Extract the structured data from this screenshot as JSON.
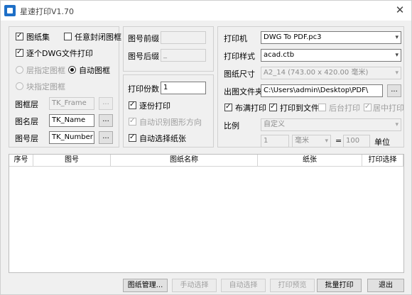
{
  "window": {
    "title": "星速打印V1.70",
    "close_glyph": "✕"
  },
  "left": {
    "frame_checkbox_label": "图纸集",
    "any_closed_label": "任意封闭图框",
    "per_dwg_label": "逐个DWG文件打印",
    "layer_frame_label": "层指定图框",
    "auto_frame_label": "自动图框",
    "block_frame_label": "块指定图框",
    "frame_layer_label": "图框层",
    "frame_layer_value": "TK_Frame",
    "name_layer_label": "图名层",
    "name_layer_value": "TK_Name",
    "number_layer_label": "图号层",
    "number_layer_value": "TK_Number",
    "browse": "..."
  },
  "middle": {
    "prefix_label": "图号前缀",
    "prefix_value": "",
    "suffix_label": "图号后缀",
    "suffix_value": "_",
    "copies_label": "打印份数",
    "copies_value": "1",
    "collate_label": "逐份打印",
    "auto_orient_label": "自动识别图形方向",
    "auto_paper_label": "自动选择纸张"
  },
  "right": {
    "printer_label": "打印机",
    "printer_value": "DWG To PDF.pc3",
    "style_label": "打印样式",
    "style_value": "acad.ctb",
    "paper_label": "图纸尺寸",
    "paper_value": "A2_14 (743.00 x 420.00 毫米)",
    "folder_label": "出图文件夹",
    "folder_value": "C:\\Users\\admin\\Desktop\\PDF\\",
    "browse": "...",
    "fill_label": "布满打印",
    "to_file_label": "打印到文件",
    "background_label": "后台打印",
    "center_label": "居中打印",
    "scale_label": "比例",
    "scale_value": "自定义",
    "scale_num": "1",
    "unit_value": "毫米",
    "equals": "=",
    "scale_den": "100",
    "unit_label": "单位"
  },
  "table": {
    "columns": [
      "序号",
      "图号",
      "图纸名称",
      "纸张",
      "打印选择"
    ]
  },
  "buttons": {
    "manage": "图纸管理...",
    "manual": "手动选择",
    "auto": "自动选择",
    "preview": "打印预览",
    "batch": "批量打印",
    "exit": "退出"
  }
}
